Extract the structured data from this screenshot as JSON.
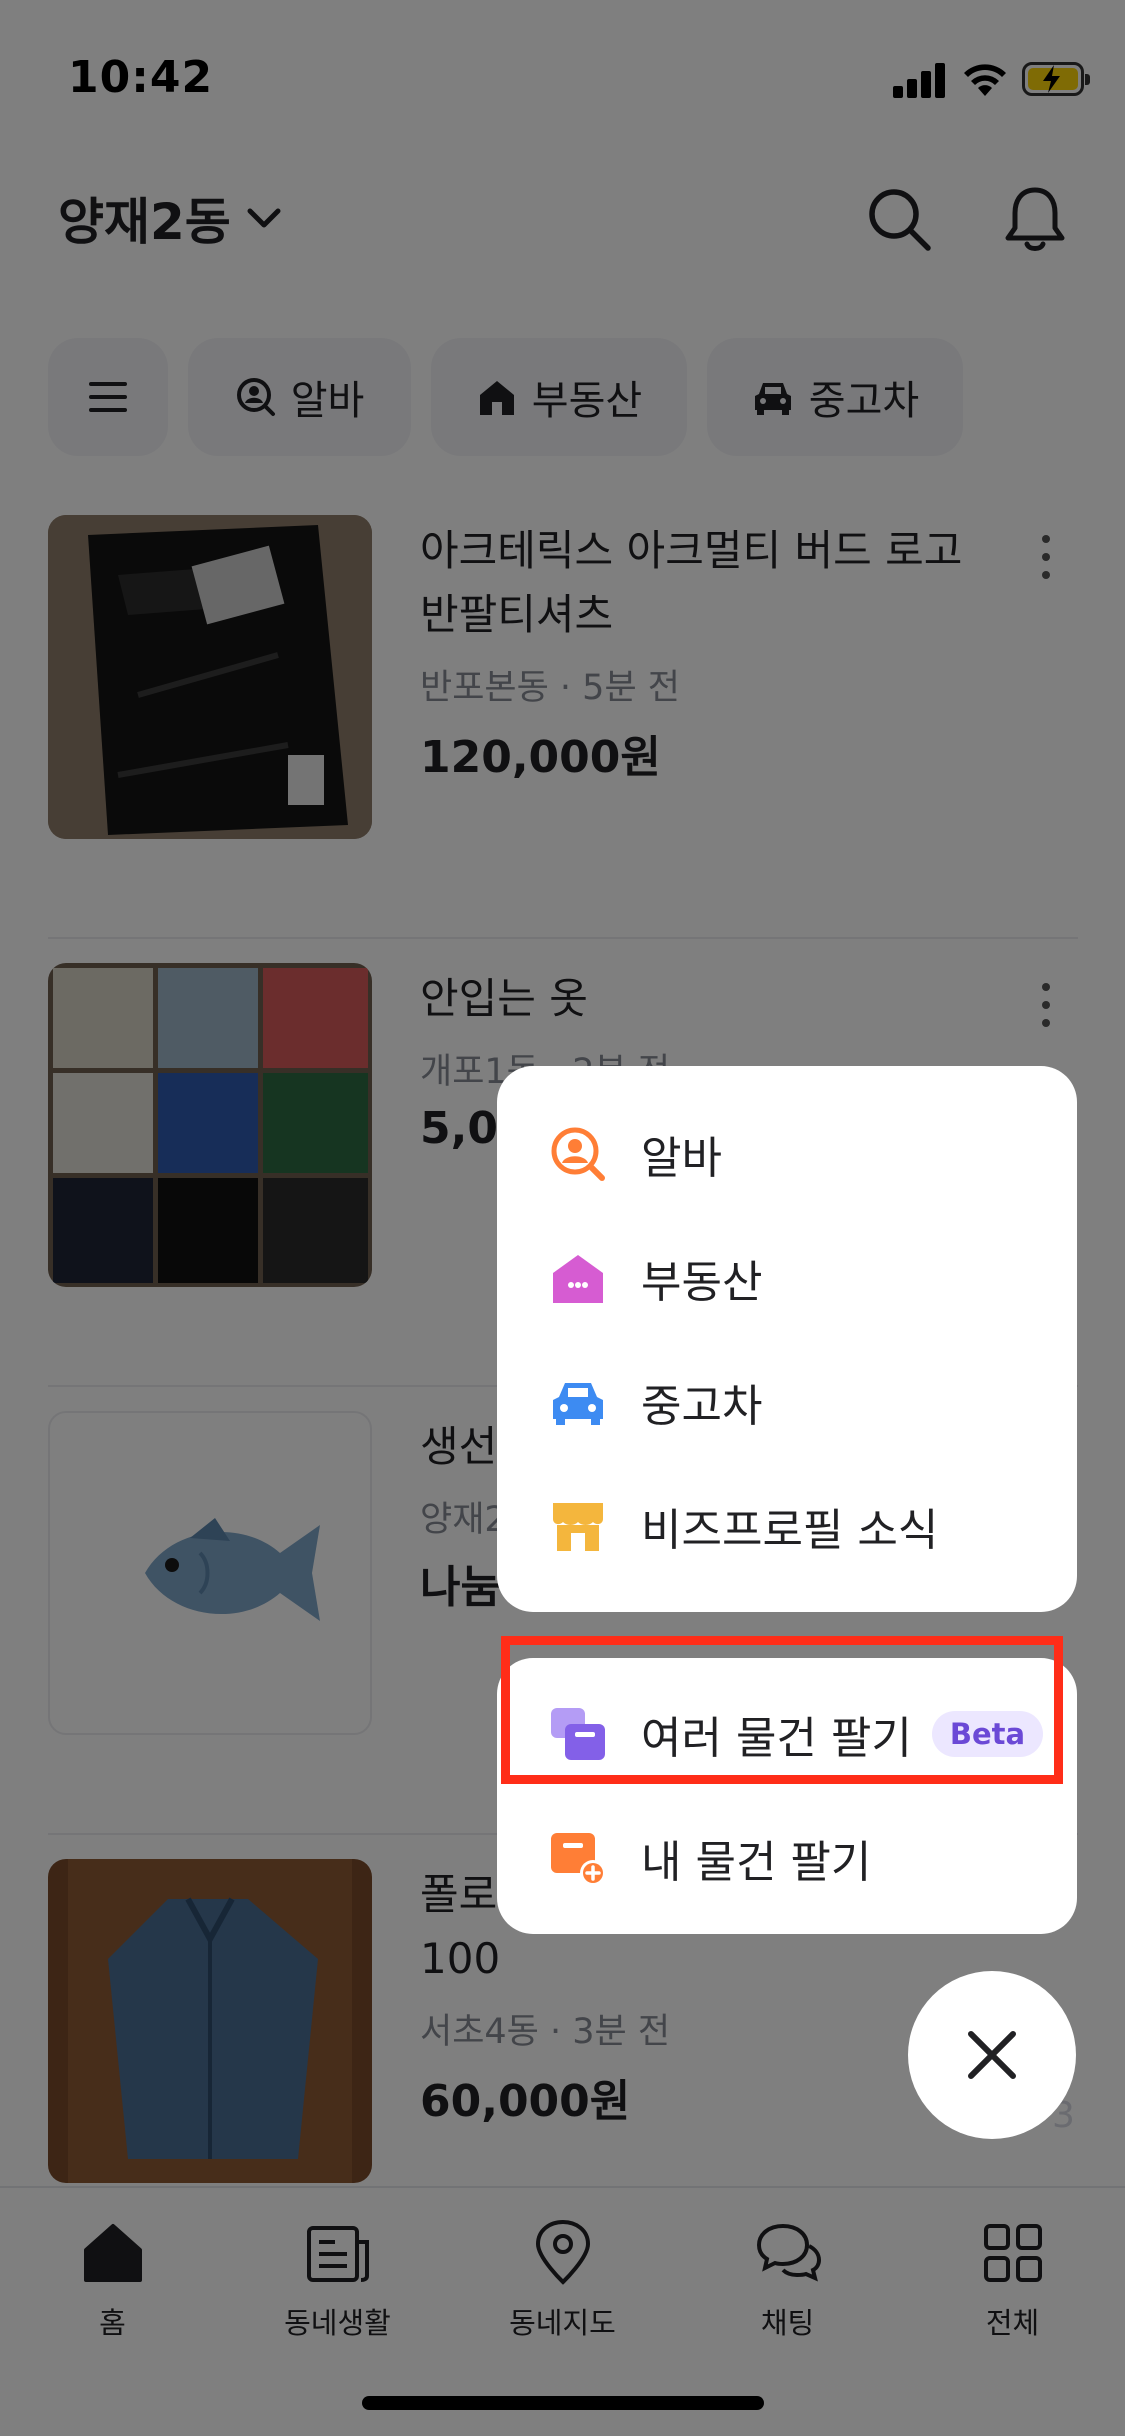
{
  "status_bar": {
    "time": "10:42"
  },
  "header": {
    "location": "양재2동"
  },
  "chips": [
    {
      "label": "알바",
      "icon": "person-search-icon"
    },
    {
      "label": "부동산",
      "icon": "house-icon"
    },
    {
      "label": "중고차",
      "icon": "car-icon"
    }
  ],
  "items": [
    {
      "title": "아크테릭스 아크멀티 버드 로고 반팔티셔츠",
      "meta": "반포본동 · 5분 전",
      "price": "120,000원"
    },
    {
      "title": "안입는 옷",
      "meta": "개포1동 · 2분 전",
      "price": "5,0"
    },
    {
      "title": "생선",
      "meta": "양재2",
      "price": "나눔"
    },
    {
      "title": "폴로",
      "title2": "100",
      "meta": "서초4동 · 3분 전",
      "price": "60,000원"
    }
  ],
  "page_indicator": "3",
  "menu": {
    "categories": [
      {
        "label": "알바",
        "icon": "person-search-icon",
        "color": "#ff7e36"
      },
      {
        "label": "부동산",
        "icon": "house-icon",
        "color": "#d65cd2"
      },
      {
        "label": "중고차",
        "icon": "car-icon",
        "color": "#3d8bf2"
      },
      {
        "label": "비즈프로필 소식",
        "icon": "store-icon",
        "color": "#f4b63d"
      }
    ],
    "sell": [
      {
        "label": "여러 물건 팔기",
        "badge": "Beta",
        "icon": "multi-items-icon",
        "color": "#8360e8"
      },
      {
        "label": "내 물건 팔기",
        "icon": "add-item-icon",
        "color": "#ff7e36"
      }
    ]
  },
  "tabbar": [
    {
      "label": "홈",
      "icon": "home-icon"
    },
    {
      "label": "동네생활",
      "icon": "newspaper-icon"
    },
    {
      "label": "동네지도",
      "icon": "map-pin-icon"
    },
    {
      "label": "채팅",
      "icon": "chat-icon"
    },
    {
      "label": "전체",
      "icon": "grid-icon"
    }
  ],
  "colors": {
    "highlight": "#ff2d18",
    "accent": "#ff7e36"
  }
}
